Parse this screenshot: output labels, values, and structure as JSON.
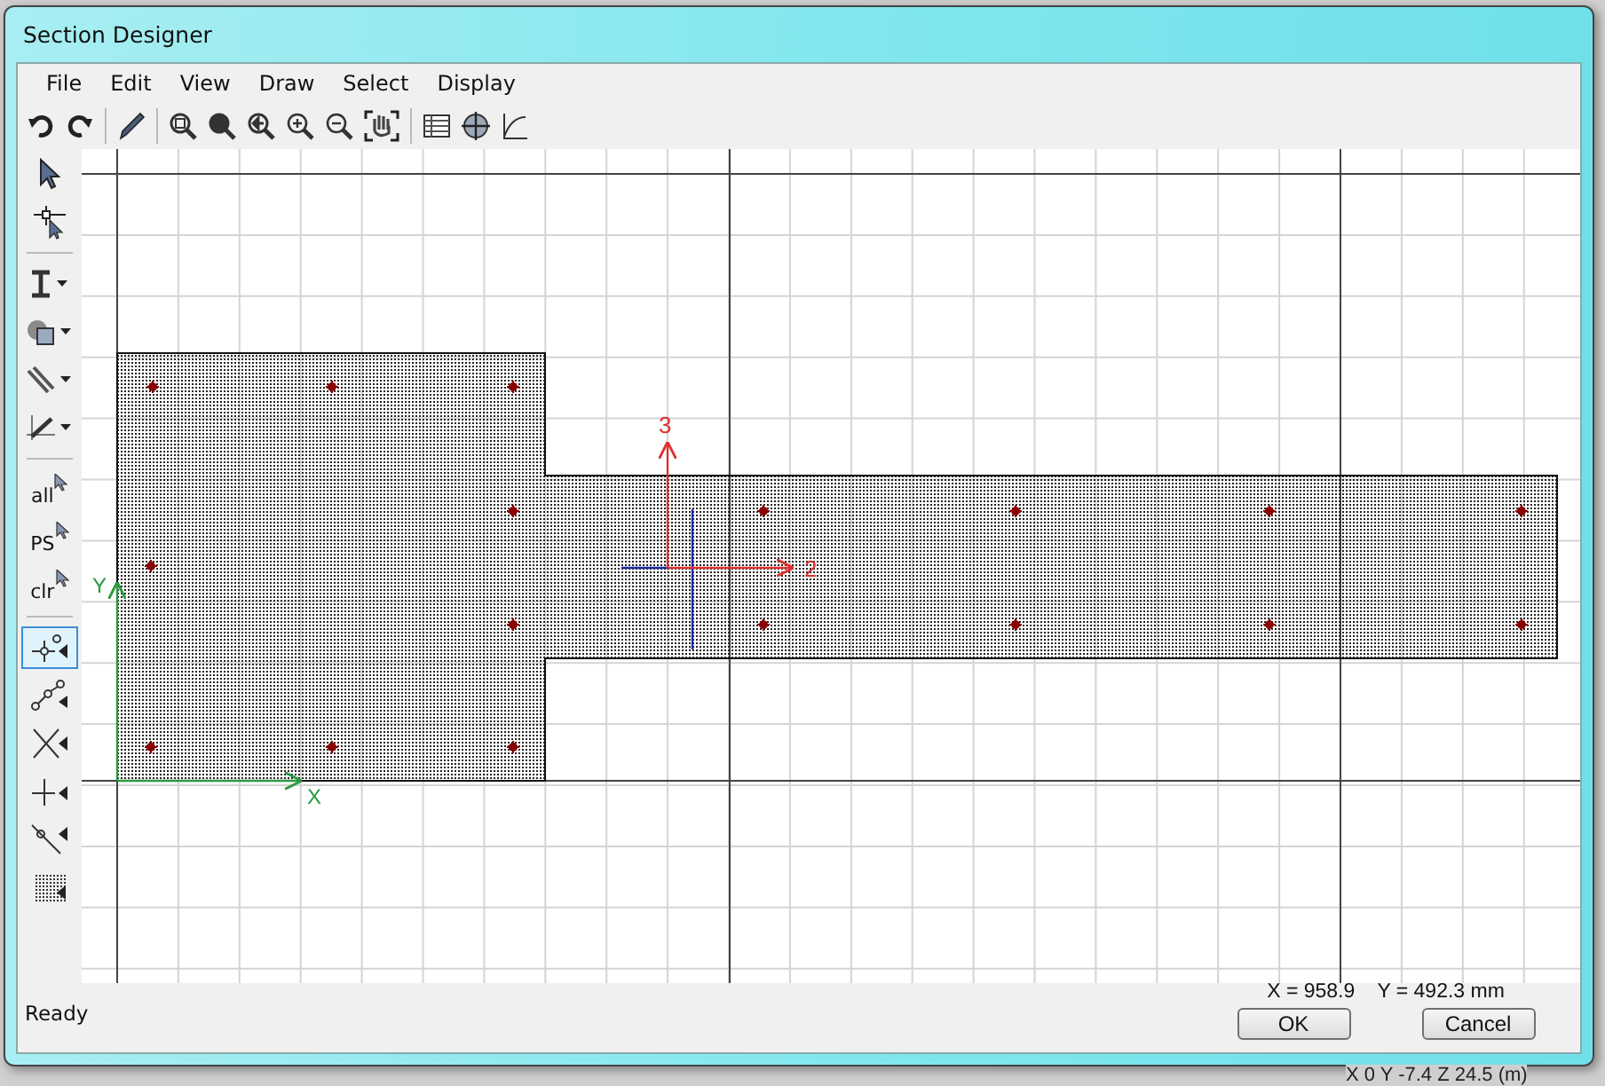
{
  "window": {
    "title": "Section Designer"
  },
  "menu": [
    "File",
    "Edit",
    "View",
    "Draw",
    "Select",
    "Display"
  ],
  "tools": [
    {
      "kind": "pointer",
      "selected": false
    },
    {
      "kind": "reshape",
      "selected": false
    },
    {
      "kind": "ibeam",
      "selected": false
    },
    {
      "kind": "shape",
      "selected": false
    },
    {
      "kind": "lines",
      "selected": false
    },
    {
      "kind": "pen",
      "selected": false
    },
    {
      "kind": "text-pointer",
      "text": "all",
      "selected": false
    },
    {
      "kind": "text-pointer",
      "text": "PS",
      "selected": false
    },
    {
      "kind": "text-pointer",
      "text": "clr",
      "selected": false
    },
    {
      "kind": "snap-point",
      "selected": true
    },
    {
      "kind": "snap-line",
      "selected": false
    },
    {
      "kind": "snap-cross",
      "selected": false
    },
    {
      "kind": "snap-mid",
      "selected": false
    },
    {
      "kind": "snap-perp",
      "selected": false
    },
    {
      "kind": "snap-grid",
      "selected": false
    }
  ],
  "canvas": {
    "local_axis_labels": [
      "3",
      "2"
    ],
    "global_axis_labels": [
      "Y",
      "X"
    ]
  },
  "status": "Ready",
  "cursor_readout": "X = 958.9    Y = 492.3 mm",
  "buttons": [
    "OK",
    "Cancel"
  ],
  "background_coordinates": "X 0  Y -7.4  Z 24.5 (m)"
}
